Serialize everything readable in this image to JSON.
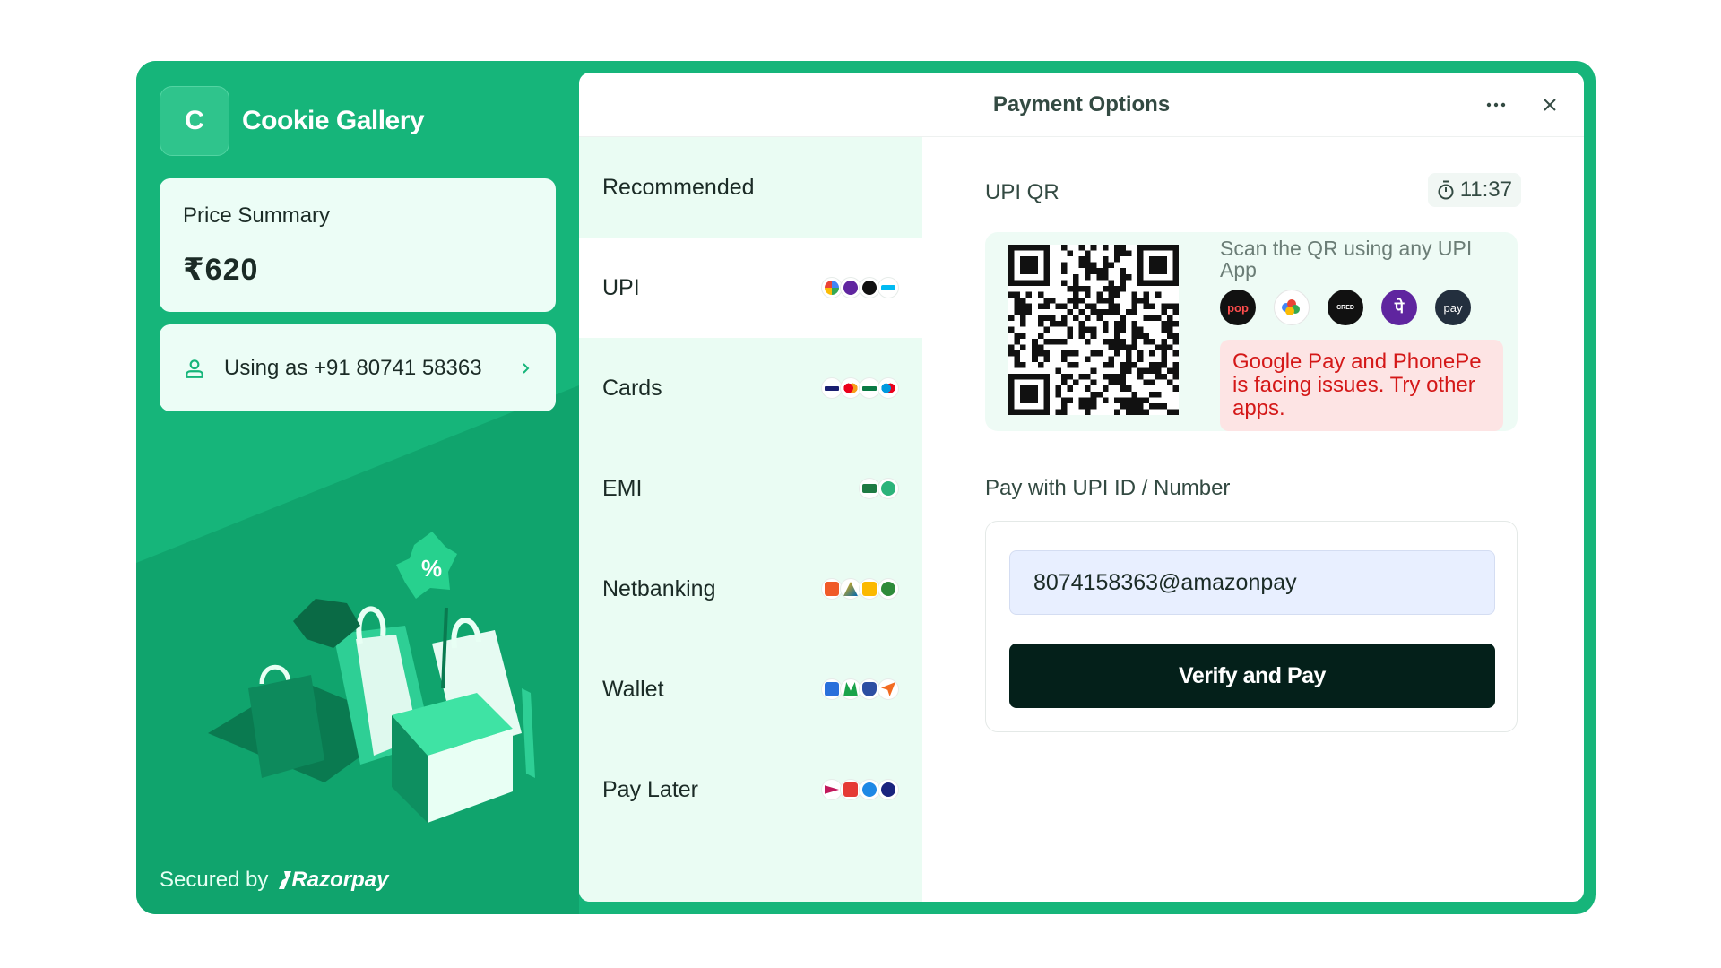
{
  "merchant": {
    "initial": "C",
    "name": "Cookie Gallery"
  },
  "price_summary": {
    "label": "Price Summary",
    "amount": "₹620"
  },
  "user": {
    "text": "Using as +91 80741 58363"
  },
  "footer": {
    "secured_by": "Secured by",
    "brand": "Razorpay"
  },
  "header": {
    "title": "Payment Options"
  },
  "menu": [
    {
      "label": "Recommended",
      "icons": []
    },
    {
      "label": "UPI",
      "icons": [
        "google-pay",
        "phonepe",
        "pop",
        "paytm"
      ],
      "selected": true
    },
    {
      "label": "Cards",
      "icons": [
        "visa",
        "mastercard",
        "rupay",
        "maestro"
      ]
    },
    {
      "label": "EMI",
      "icons": [
        "card-emi",
        "zestmoney"
      ]
    },
    {
      "label": "Netbanking",
      "icons": [
        "bank-a",
        "bank-b",
        "bank-c",
        "bank-d"
      ]
    },
    {
      "label": "Wallet",
      "icons": [
        "mobikwik",
        "airtel",
        "wallet-shield",
        "freecharge"
      ]
    },
    {
      "label": "Pay Later",
      "icons": [
        "lazypay",
        "simpl",
        "icici-paylater",
        "olamoney"
      ]
    }
  ],
  "upi_qr": {
    "title": "UPI QR",
    "timer": "11:37",
    "scan_text": "Scan the QR using any UPI App",
    "apps": [
      {
        "name": "pop",
        "label": "pop",
        "color": "#111111"
      },
      {
        "name": "google-pay",
        "label": "",
        "color": "#ffffff"
      },
      {
        "name": "cred",
        "label": "CRED",
        "color": "#111111"
      },
      {
        "name": "phonepe",
        "label": "पे",
        "color": "#5f259f"
      },
      {
        "name": "amazon-pay",
        "label": "pay",
        "color": "#232f3e"
      }
    ],
    "warning": "Google Pay and PhonePe is facing issues. Try other apps."
  },
  "upi_id": {
    "label": "Pay with UPI ID / Number",
    "value": "8074158363@amazonpay",
    "button": "Verify and Pay"
  },
  "colors": {
    "brand": "#16b57a",
    "menu_bg": "#eafcf3",
    "button": "#04201a",
    "warning_text": "#d41818",
    "warning_bg": "#fde4e4"
  }
}
